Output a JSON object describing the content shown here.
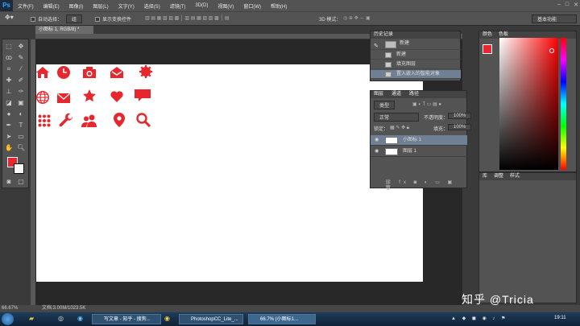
{
  "app": {
    "logo": "Ps"
  },
  "menu": [
    "文件(F)",
    "编辑(E)",
    "图像(I)",
    "图层(L)",
    "文字(Y)",
    "选择(S)",
    "滤镜(T)",
    "3D(D)",
    "视图(V)",
    "窗口(W)",
    "帮助(H)"
  ],
  "options": {
    "auto_select_label": "自动选择：",
    "auto_select_value": "组",
    "show_transform_label": "显示变换控件",
    "mode_3d_label": "3D 模式：",
    "workspace_value": "基本功能"
  },
  "document": {
    "tab_label": "小图标 1, RGB/8) *"
  },
  "history": {
    "tab_label": "历史记录",
    "snapshot_label": "新建",
    "items": [
      "新建",
      "填充图层",
      "置入嵌入的智能对象"
    ]
  },
  "layers": {
    "tabs": [
      "图层",
      "通道",
      "路径"
    ],
    "filter_label": "类型",
    "blend_mode": "正常",
    "opacity_label": "不透明度：",
    "opacity_value": "100%",
    "lock_label": "锁定：",
    "fill_label": "填充：",
    "fill_value": "100%",
    "items": [
      {
        "name": "小图标 1",
        "selected": true
      },
      {
        "name": "图层 1",
        "selected": false
      }
    ]
  },
  "color_panel": {
    "tabs": [
      "颜色",
      "色板"
    ],
    "foreground": "#e8262d",
    "background": "#ffffff"
  },
  "adjust_panel": {
    "tabs": [
      "库",
      "调整",
      "样式"
    ]
  },
  "status": {
    "zoom": "66.67%",
    "doc_size": "文档:3.00M/1023.5K"
  },
  "taskbar": {
    "tasks": [
      "写文章 - 知乎 - 搜狗...",
      "PhotoshopCC_Lite_...",
      "66.7% (小图标1..."
    ],
    "clock": "19:11"
  },
  "watermark": "知乎 @Tricia",
  "accent_color": "#e8262d"
}
